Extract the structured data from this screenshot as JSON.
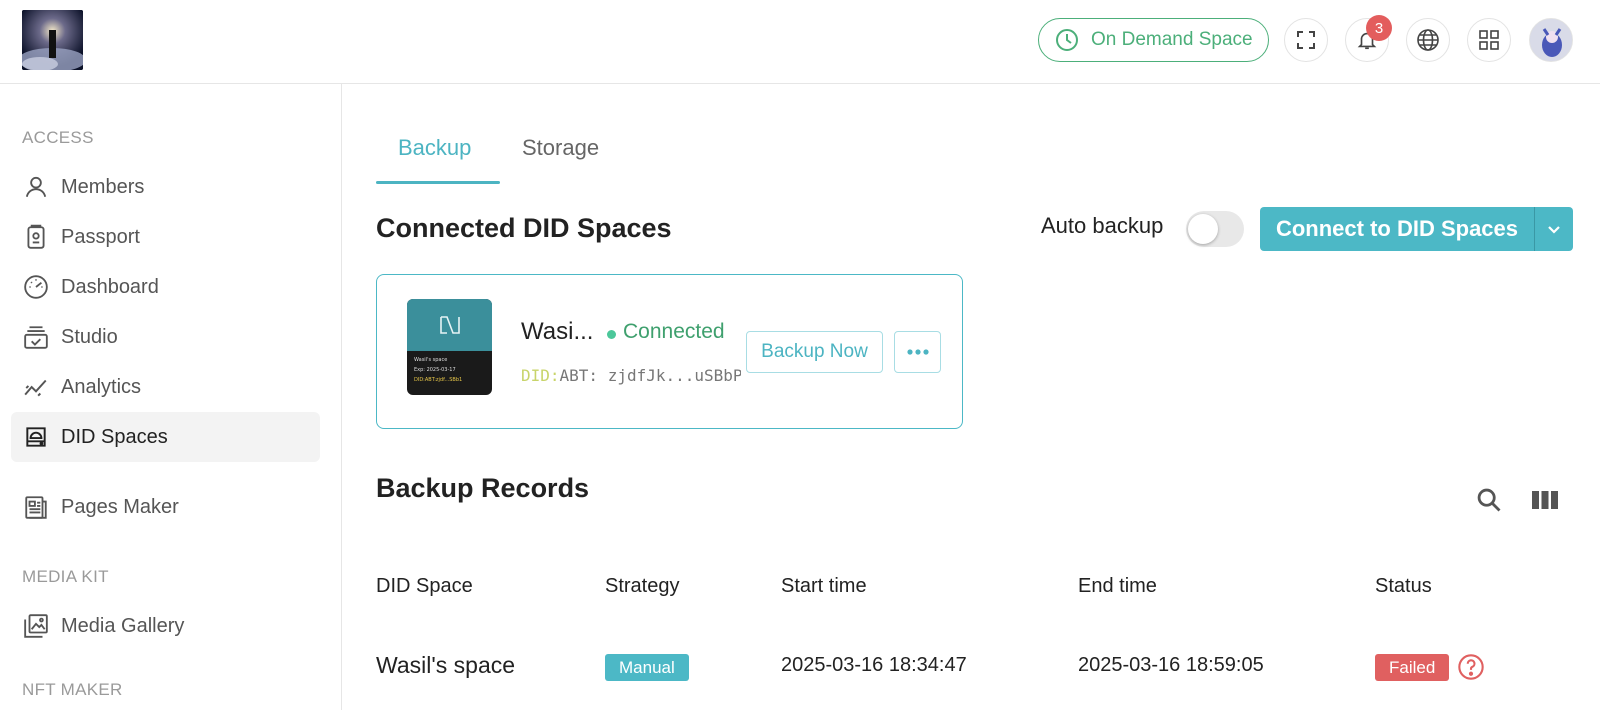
{
  "header": {
    "space_label": "On Demand Space",
    "notification_count": "3",
    "colors": {
      "accent": "#4cb8c6",
      "space_green": "#4caf7a",
      "badge": "#e35d5d"
    }
  },
  "sidebar": {
    "sections": [
      {
        "title": "ACCESS"
      },
      {
        "title": "MEDIA KIT"
      },
      {
        "title": "NFT MAKER"
      }
    ],
    "items": [
      {
        "label": "Members",
        "icon": "person-icon"
      },
      {
        "label": "Passport",
        "icon": "passport-icon"
      },
      {
        "label": "Dashboard",
        "icon": "gauge-icon"
      },
      {
        "label": "Studio",
        "icon": "studio-icon"
      },
      {
        "label": "Analytics",
        "icon": "analytics-icon"
      },
      {
        "label": "DID Spaces",
        "icon": "drive-icon",
        "active": true
      },
      {
        "label": "Pages Maker",
        "icon": "page-icon"
      },
      {
        "label": "Media Gallery",
        "icon": "gallery-icon"
      }
    ]
  },
  "tabs": [
    {
      "label": "Backup",
      "active": true
    },
    {
      "label": "Storage"
    }
  ],
  "connected": {
    "title": "Connected DID Spaces",
    "auto_backup_label": "Auto backup",
    "auto_backup_on": false,
    "connect_label": "Connect to DID Spaces",
    "card": {
      "name": "Wasi...",
      "status": "Connected",
      "did_prefix": "DID:",
      "did_value": "ABT: zjdfJk...uSBbP",
      "backup_label": "Backup Now",
      "thumb_title": "Wasil's space",
      "thumb_exp": "Exp: 2025-03-17",
      "thumb_did": "DID:ABT:zjdf...SBb1"
    }
  },
  "records": {
    "title": "Backup Records",
    "columns": [
      "DID Space",
      "Strategy",
      "Start time",
      "End time",
      "Status"
    ],
    "rows": [
      {
        "space": "Wasil's space",
        "strategy": "Manual",
        "start": "2025-03-16 18:34:47",
        "end": "2025-03-16 18:59:05",
        "status": "Failed"
      }
    ]
  }
}
